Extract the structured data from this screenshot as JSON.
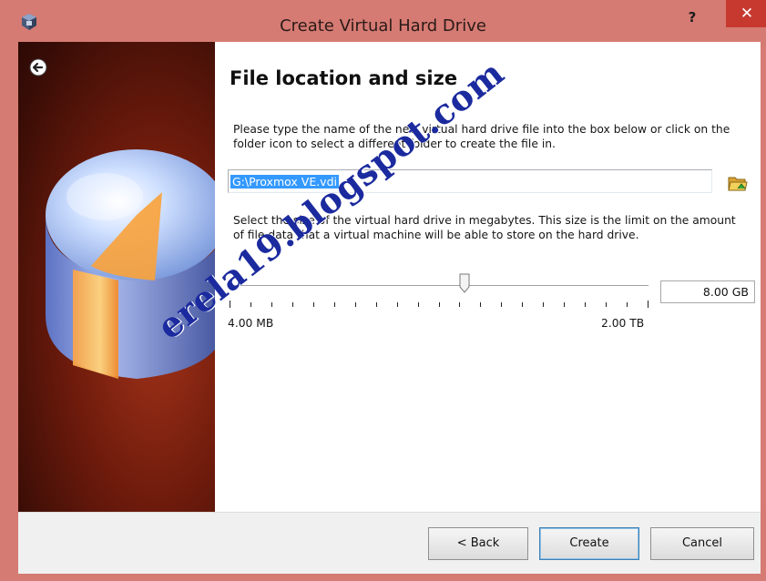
{
  "window": {
    "title": "Create Virtual Hard Drive",
    "help_label": "?",
    "close_label": "✕",
    "app_icon": "virtualbox-icon",
    "frame_color": "#d57b73",
    "close_color": "#c7392f"
  },
  "page": {
    "back_icon": "back-arrow-icon",
    "heading": "File location and size",
    "location_description": "Please type the name of the new virtual hard drive file into the box below or click on the folder icon to select a different folder to create the file in.",
    "file_path": "G:\\Proxmox VE.vdi",
    "folder_icon": "folder-open-icon",
    "size_description": "Select the size of the virtual hard drive in megabytes. This size is the limit on the amount of file data that a virtual machine will be able to store on the hard drive.",
    "slider_min_label": "4.00 MB",
    "slider_max_label": "2.00 TB",
    "slider_position_fraction": 0.56,
    "size_value": "8.00 GB"
  },
  "buttons": {
    "back": "< Back",
    "create": "Create",
    "cancel": "Cancel"
  },
  "watermark": "erela19.blogspot.com",
  "colors": {
    "selection": "#3399ff",
    "watermark": "#1b2a9e"
  }
}
